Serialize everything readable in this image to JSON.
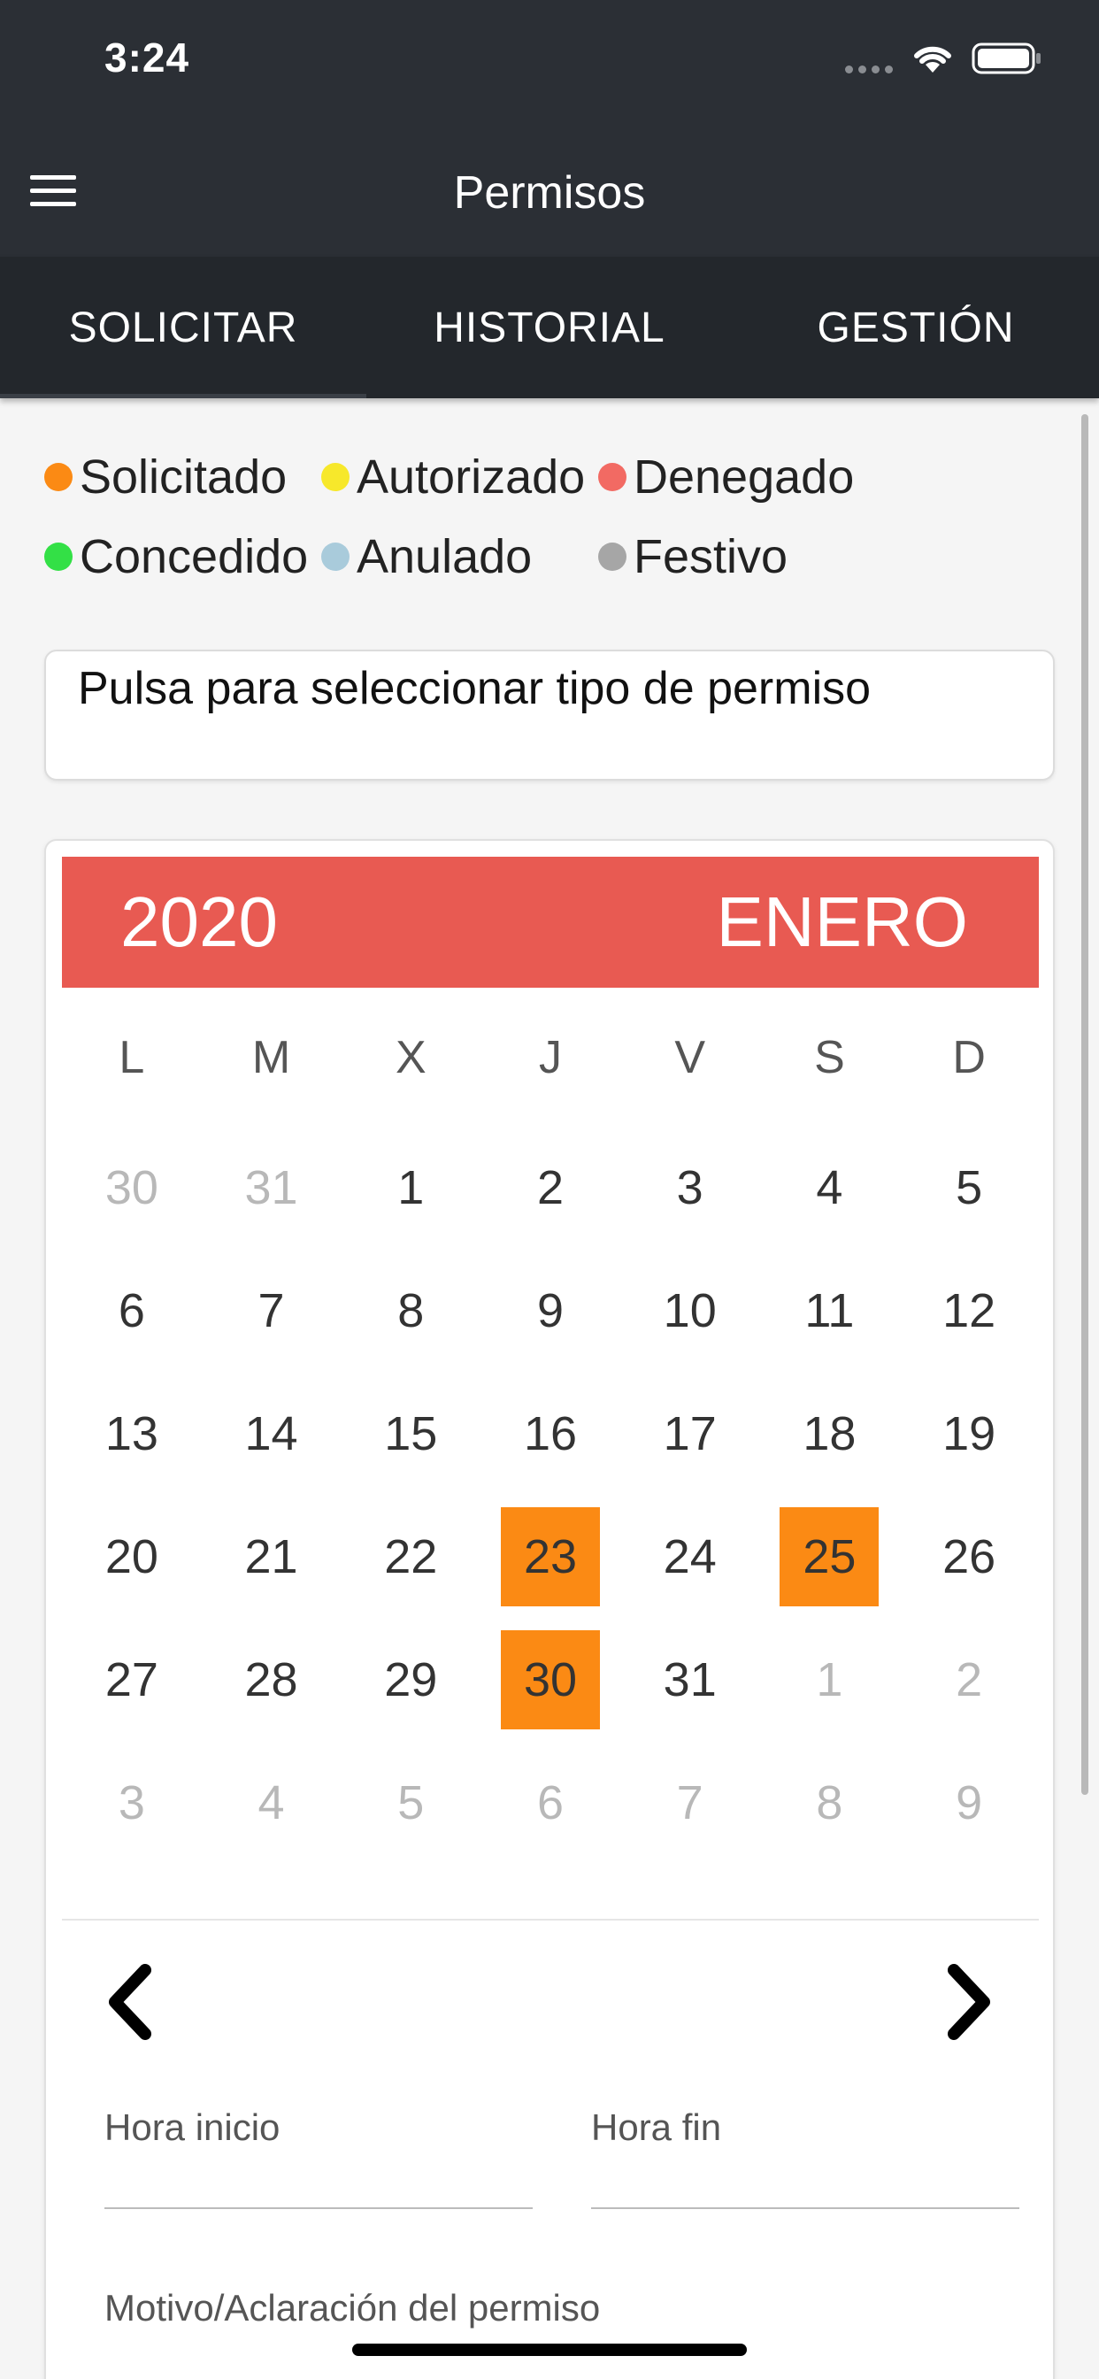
{
  "status_bar": {
    "time": "3:24",
    "icons": [
      "signal-dots-icon",
      "wifi-icon",
      "battery-icon"
    ]
  },
  "header": {
    "title": "Permisos",
    "menu_icon": "hamburger-menu-icon"
  },
  "tabs": [
    {
      "label": "SOLICITAR",
      "active": true
    },
    {
      "label": "HISTORIAL",
      "active": false
    },
    {
      "label": "GESTIÓN",
      "active": false
    }
  ],
  "legend": [
    [
      {
        "label": "Solicitado",
        "color": "#fb8a14"
      },
      {
        "label": "Autorizado",
        "color": "#f7e82b"
      },
      {
        "label": "Denegado",
        "color": "#f26a63"
      }
    ],
    [
      {
        "label": "Concedido",
        "color": "#33e046"
      },
      {
        "label": "Anulado",
        "color": "#a9cbdb"
      },
      {
        "label": "Festivo",
        "color": "#a6a6a6"
      }
    ]
  ],
  "selector": {
    "placeholder": "Pulsa para seleccionar tipo de permiso"
  },
  "calendar": {
    "year": "2020",
    "month": "ENERO",
    "header_color": "#e85a52",
    "marked_color": "#fb8a14",
    "weekdays": [
      "L",
      "M",
      "X",
      "J",
      "V",
      "S",
      "D"
    ],
    "days": [
      {
        "d": "30",
        "other": true
      },
      {
        "d": "31",
        "other": true
      },
      {
        "d": "1"
      },
      {
        "d": "2"
      },
      {
        "d": "3"
      },
      {
        "d": "4"
      },
      {
        "d": "5"
      },
      {
        "d": "6"
      },
      {
        "d": "7"
      },
      {
        "d": "8"
      },
      {
        "d": "9"
      },
      {
        "d": "10"
      },
      {
        "d": "11"
      },
      {
        "d": "12"
      },
      {
        "d": "13"
      },
      {
        "d": "14"
      },
      {
        "d": "15"
      },
      {
        "d": "16"
      },
      {
        "d": "17"
      },
      {
        "d": "18"
      },
      {
        "d": "19"
      },
      {
        "d": "20"
      },
      {
        "d": "21"
      },
      {
        "d": "22"
      },
      {
        "d": "23",
        "marked": true
      },
      {
        "d": "24"
      },
      {
        "d": "25",
        "marked": true
      },
      {
        "d": "26"
      },
      {
        "d": "27"
      },
      {
        "d": "28"
      },
      {
        "d": "29"
      },
      {
        "d": "30",
        "marked": true
      },
      {
        "d": "31"
      },
      {
        "d": "1",
        "other": true
      },
      {
        "d": "2",
        "other": true
      },
      {
        "d": "3",
        "other": true
      },
      {
        "d": "4",
        "other": true
      },
      {
        "d": "5",
        "other": true
      },
      {
        "d": "6",
        "other": true
      },
      {
        "d": "7",
        "other": true
      },
      {
        "d": "8",
        "other": true
      },
      {
        "d": "9",
        "other": true
      }
    ],
    "prev_icon": "chevron-left-icon",
    "next_icon": "chevron-right-icon"
  },
  "form": {
    "start_label": "Hora inicio",
    "end_label": "Hora fin",
    "reason_label": "Motivo/Aclaración del permiso"
  }
}
